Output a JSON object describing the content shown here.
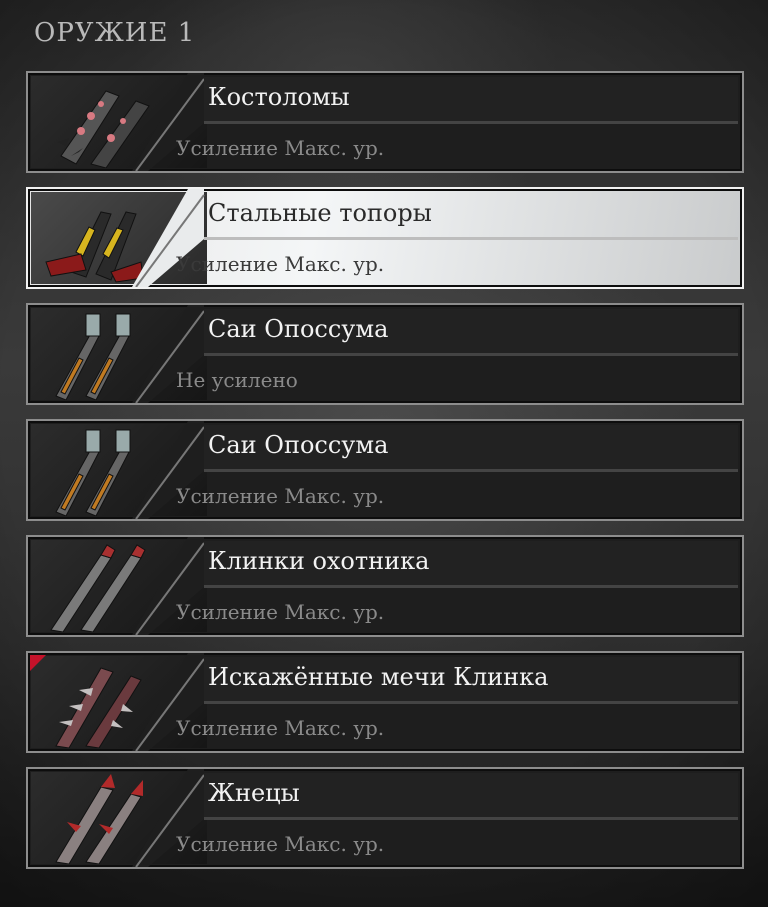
{
  "section_title": "ОРУЖИЕ 1",
  "weapons": [
    {
      "name": "Костоломы",
      "status": "Усиление Макс. ур.",
      "icon": "bone-crusher-gauntlets-icon",
      "selected": false,
      "new": false,
      "accent": "#c9616a"
    },
    {
      "name": "Стальные топоры",
      "status": "Усиление Макс. ур.",
      "icon": "steel-axes-icon",
      "selected": true,
      "new": false,
      "accent": "#d7b51f"
    },
    {
      "name": "Саи Опоссума",
      "status": "Не усилено",
      "icon": "opossum-sai-icon",
      "selected": false,
      "new": false,
      "accent": "#c07a22"
    },
    {
      "name": "Саи Опоссума",
      "status": "Усиление Макс. ур.",
      "icon": "opossum-sai-icon",
      "selected": false,
      "new": false,
      "accent": "#c07a22"
    },
    {
      "name": "Клинки охотника",
      "status": "Усиление Макс. ур.",
      "icon": "hunter-blades-icon",
      "selected": false,
      "new": false,
      "accent": "#a93030"
    },
    {
      "name": "Искажённые мечи Клинка",
      "status": "Усиление Макс. ур.",
      "icon": "distorted-blade-swords-icon",
      "selected": false,
      "new": true,
      "accent": "#9d3a3f"
    },
    {
      "name": "Жнецы",
      "status": "Усиление Макс. ур.",
      "icon": "reapers-icon",
      "selected": false,
      "new": false,
      "accent": "#b22a2a"
    }
  ],
  "colors": {
    "panel_bg": "#1e1e1e",
    "panel_border": "#8d8d8d",
    "selected_bg": "#eef0f1",
    "title_text": "#f2f2f2",
    "status_text": "#8a8a8a",
    "new_flag": "#c4122a"
  }
}
